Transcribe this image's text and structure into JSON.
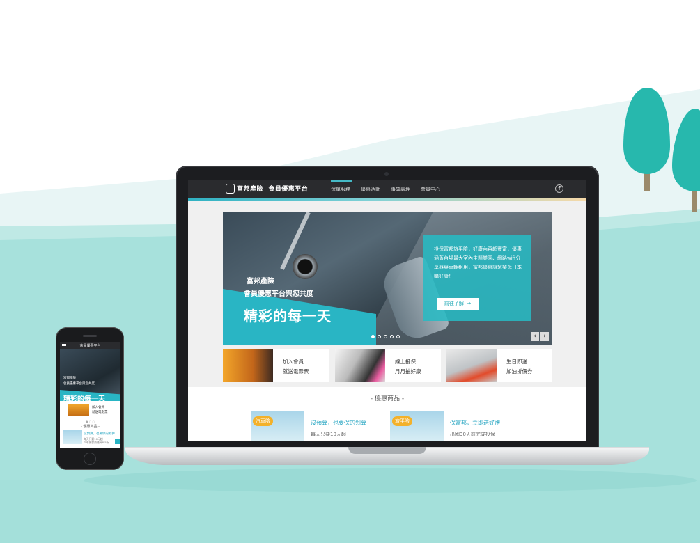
{
  "site": {
    "brand_cn": "富邦產險",
    "platform_name": "會員優惠平台",
    "nav_items": [
      "保單服務",
      "優惠活動",
      "事故處理",
      "會員中心"
    ],
    "active_nav": "保單服務",
    "social": "f"
  },
  "hero": {
    "brand": "富邦產險",
    "subtitle": "會員優惠平台與您共度",
    "title": "精彩的每一天",
    "panel_text": "投保富邦旅平險，好康內容超豐富，優惠涵蓋台場最大室內主題樂園、網路wifi分享器與車輛租用，富邦優惠讓您樂逛日本購好康！",
    "cta_label": "前往了解",
    "slide_count": 5,
    "active_slide": 1
  },
  "cards": [
    {
      "line1": "加入會員",
      "line2": "就送電影票"
    },
    {
      "line1": "線上投保",
      "line2": "月月抽好康"
    },
    {
      "line1": "生日即送",
      "line2": "加油折價券"
    }
  ],
  "section": {
    "title": "- 優惠商品 -",
    "products": [
      {
        "tag": "汽車險",
        "title": "沒預算，也要保的划算",
        "desc": "每天只要10元起"
      },
      {
        "tag": "旅平險",
        "title": "保富邦，立即送好禮",
        "desc": "出國30天前完成投保"
      }
    ]
  },
  "phone": {
    "nav_title": "會員優惠平台",
    "hero_line1": "富邦產險",
    "hero_line2": "會員優惠平台與您共度",
    "hero_title": "精彩的每一天",
    "card_line1": "加入會員",
    "card_line2": "就送電影票",
    "section_title": "- 優惠商品 -",
    "product_title": "沒預算，也要保的划算",
    "product_desc1": "每天只要10元起",
    "product_desc2": "汽車險保費最高8.5折"
  },
  "colors": {
    "accent": "#29b5c4",
    "nav_bg": "#2a2b2e",
    "tag": "#f3b12a",
    "link": "#2aa7c3"
  }
}
